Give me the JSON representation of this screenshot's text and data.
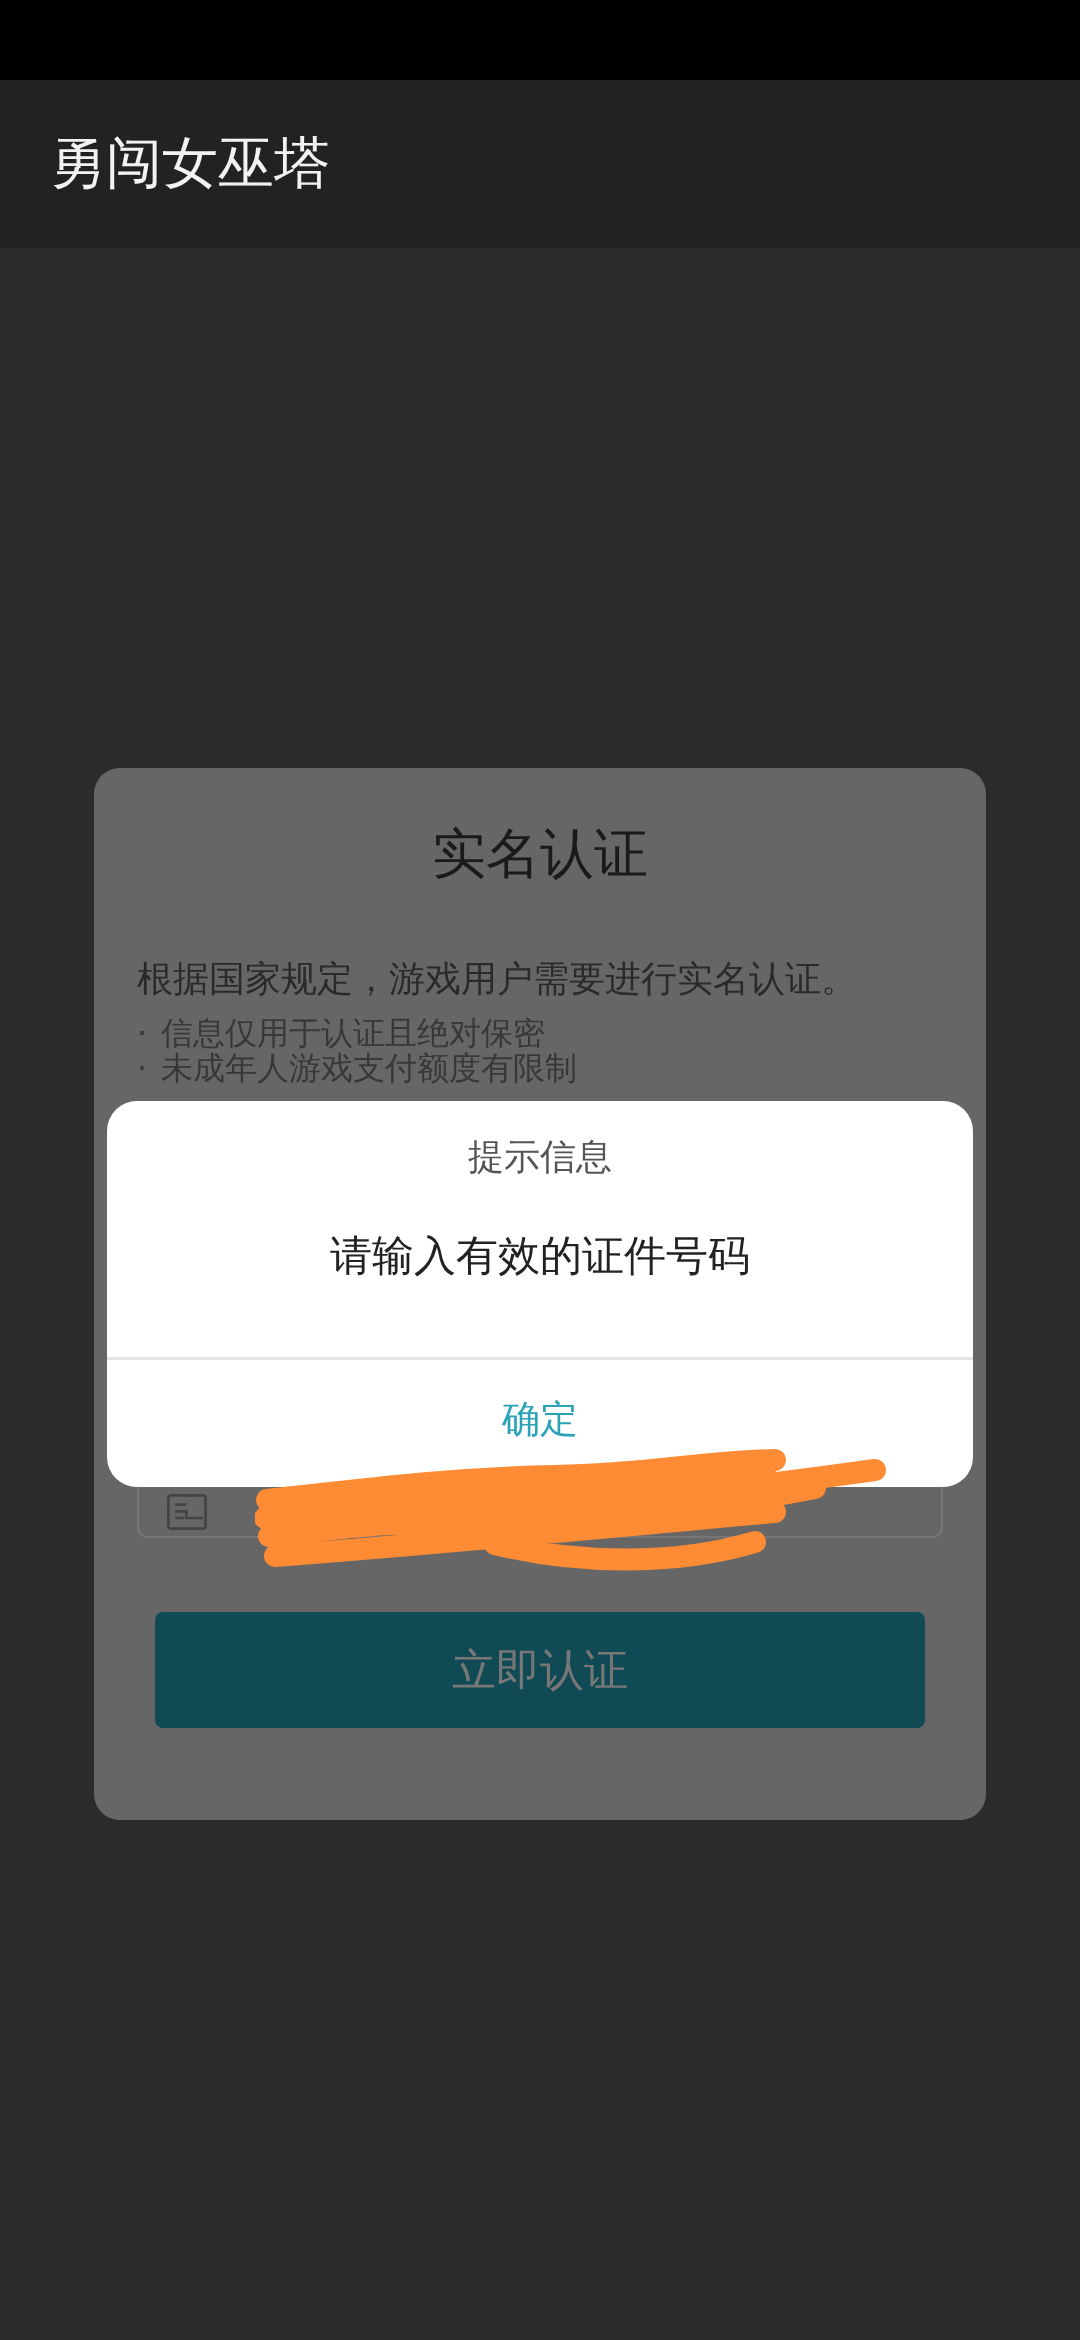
{
  "app_bar": {
    "title": "勇闯女巫塔"
  },
  "verify_card": {
    "title": "实名认证",
    "intro": "根据国家规定，游戏用户需要进行实名认证。",
    "notes": [
      {
        "bullet": "·",
        "text": "信息仅用于认证且绝对保密"
      },
      {
        "bullet": "·",
        "text": "未成年人游戏支付额度有限制"
      }
    ],
    "id_field": {
      "kind": "id"
    },
    "submit_button": "立即认证"
  },
  "alert": {
    "title": "提示信息",
    "message": "请输入有效的证件号码",
    "confirm_button": "确定"
  }
}
